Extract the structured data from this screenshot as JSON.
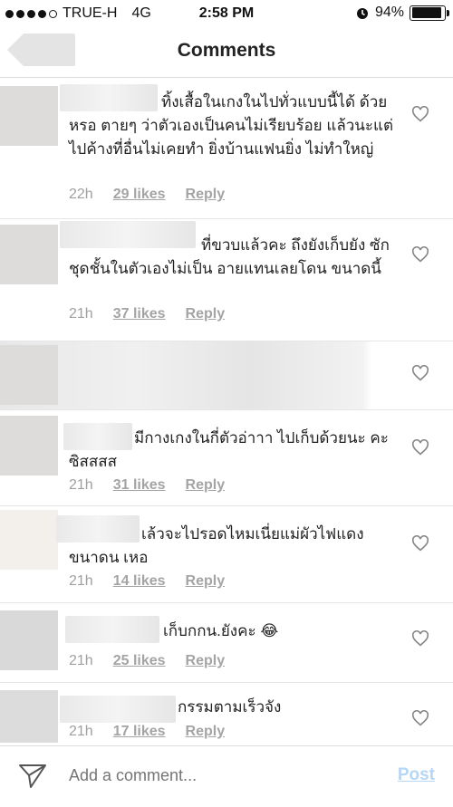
{
  "status": {
    "carrier": "TRUE-H",
    "network": "4G",
    "time": "2:58 PM",
    "battery": "94%",
    "battery_level": 0.94
  },
  "nav": {
    "title": "Comments"
  },
  "comments": [
    {
      "text": "ทิ้งเสื้อในเกงในไปทั่วแบบนี้ได้ ด้วยหรอ ตายๆ ว่าตัวเองเป็นคนไม่เรียบร้อย แล้วนะแต่ไปค้างที่อื่นไม่เคยทำ ยิ่งบ้านแฟนยิ่ง ไม่ทำใหญ่",
      "time": "22h",
      "likes": "29 likes",
      "reply": "Reply"
    },
    {
      "text": "ที่ขวบแล้วคะ ถึงยังเก็บยัง ซัก ชุดชั้นในตัวเองไม่เป็น อายแทนเลยโดน ขนาดนี้",
      "time": "21h",
      "likes": "37 likes",
      "reply": "Reply"
    },
    {
      "text": "",
      "time": "",
      "likes": "",
      "reply": ""
    },
    {
      "text": "มีกางเกงในกี่ตัวอ่าาา ไปเก็บด้วยนะ คะซิสสสส",
      "time": "21h",
      "likes": "31 likes",
      "reply": "Reply"
    },
    {
      "text": "เล้วจะไปรอดไหมเนี่ยแม่ผัวไฟแดง ขนาดน เหอ",
      "time": "21h",
      "likes": "14 likes",
      "reply": "Reply"
    },
    {
      "text": "เก็บกกน.ยังคะ 😂",
      "time": "21h",
      "likes": "25 likes",
      "reply": "Reply"
    },
    {
      "text": "กรรมตามเร็วจัง",
      "time": "21h",
      "likes": "17 likes",
      "reply": "Reply"
    }
  ],
  "footer": {
    "placeholder": "Add a comment...",
    "post_label": "Post"
  },
  "icons": {
    "back": "back-arrow-icon",
    "heart": "heart-icon",
    "send": "send-icon"
  },
  "colors": {
    "post_disabled": "#b7d6f3",
    "meta_text": "#a4a4a4"
  }
}
